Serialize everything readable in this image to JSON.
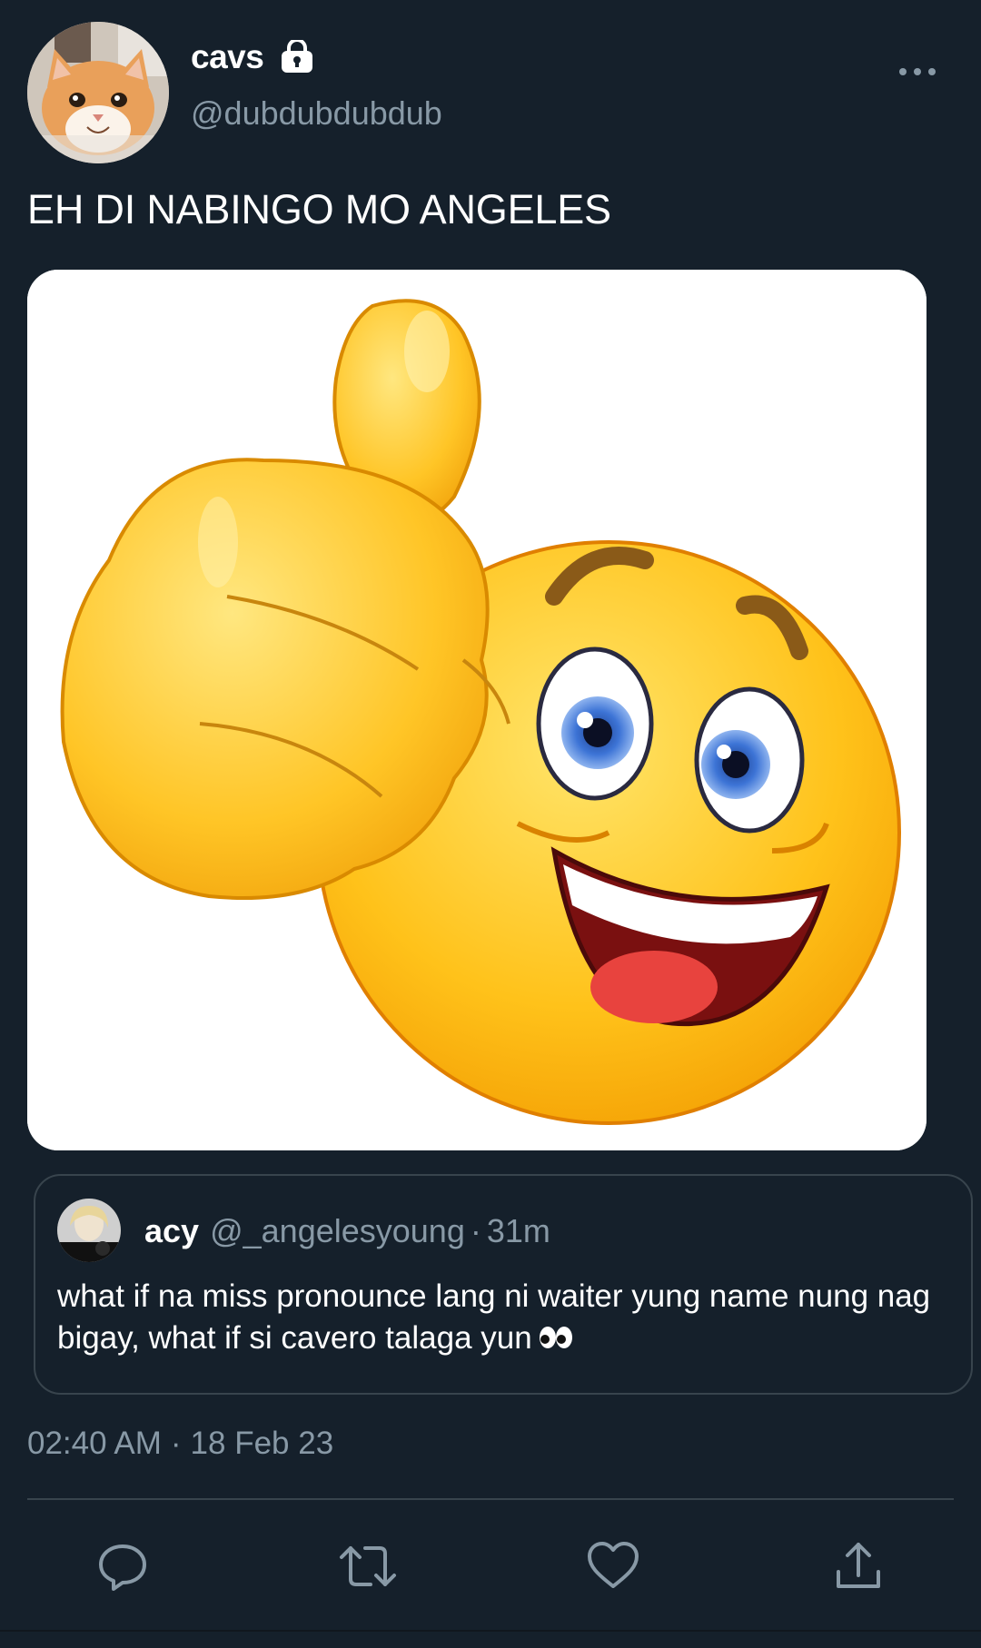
{
  "tweet": {
    "display_name": "cavs",
    "handle": "@dubdubdubdub",
    "text": "EH DI NABINGO MO ANGELES",
    "timestamp_time": "02:40 AM",
    "timestamp_date": "18 Feb 23"
  },
  "quote": {
    "display_name": "acy",
    "handle": "@_angelesyoung",
    "separator": "·",
    "age": "31m",
    "text": "what if na miss pronounce lang ni waiter yung name nung nag bigay, what if si cavero talaga yun"
  },
  "icons": {
    "lock": "lock-icon",
    "more": "more-icon",
    "reply": "reply-icon",
    "retweet": "retweet-icon",
    "like": "heart-icon",
    "share": "share-icon",
    "eyes": "eyes-emoji"
  },
  "colors": {
    "background": "#15202b",
    "secondary_text": "#8899a6",
    "border": "#38444d"
  }
}
